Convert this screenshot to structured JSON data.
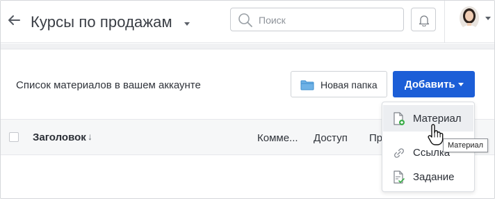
{
  "header": {
    "title": "Курсы по продажам",
    "back_icon": "arrow-left-icon",
    "search": {
      "placeholder": "Поиск",
      "value": "",
      "icon": "search-icon"
    },
    "notifications_icon": "bell-icon",
    "avatar_icon": "user-avatar"
  },
  "toolbar": {
    "caption": "Список материалов в вашем аккаунте",
    "new_folder_label": "Новая папка",
    "new_folder_icon": "folder-icon",
    "add_label": "Добавить",
    "accent_color": "#1c5ed7"
  },
  "table": {
    "columns": [
      {
        "label": "Заголовок",
        "sortable": true
      },
      {
        "label": "Комме..."
      },
      {
        "label": "Доступ"
      },
      {
        "label": "Пр"
      }
    ],
    "sort_icon": "↓"
  },
  "add_menu": {
    "items": [
      {
        "label": "Материал",
        "icon": "document-add-icon",
        "hovered": true
      },
      {
        "label": "Ссылка",
        "icon": "link-icon"
      },
      {
        "label": "Задание",
        "icon": "task-icon"
      }
    ]
  },
  "tooltip": {
    "text": "Материал"
  }
}
